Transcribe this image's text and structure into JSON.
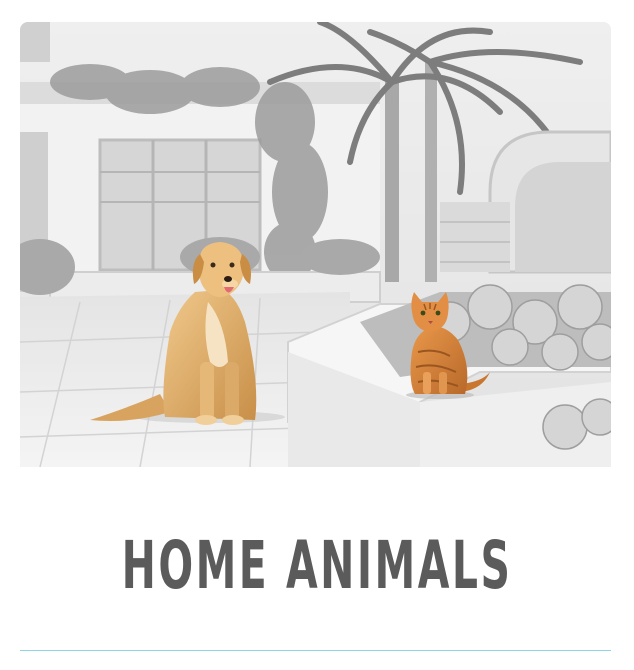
{
  "card": {
    "title": "HOME ANIMALS"
  },
  "hero_image": {
    "subjects": [
      "dog",
      "cat"
    ]
  },
  "colors": {
    "title_text": "#5b5b5b",
    "divider": "#8fd3ea",
    "dog_fur": "#e3b06c",
    "cat_fur": "#d9853a"
  }
}
